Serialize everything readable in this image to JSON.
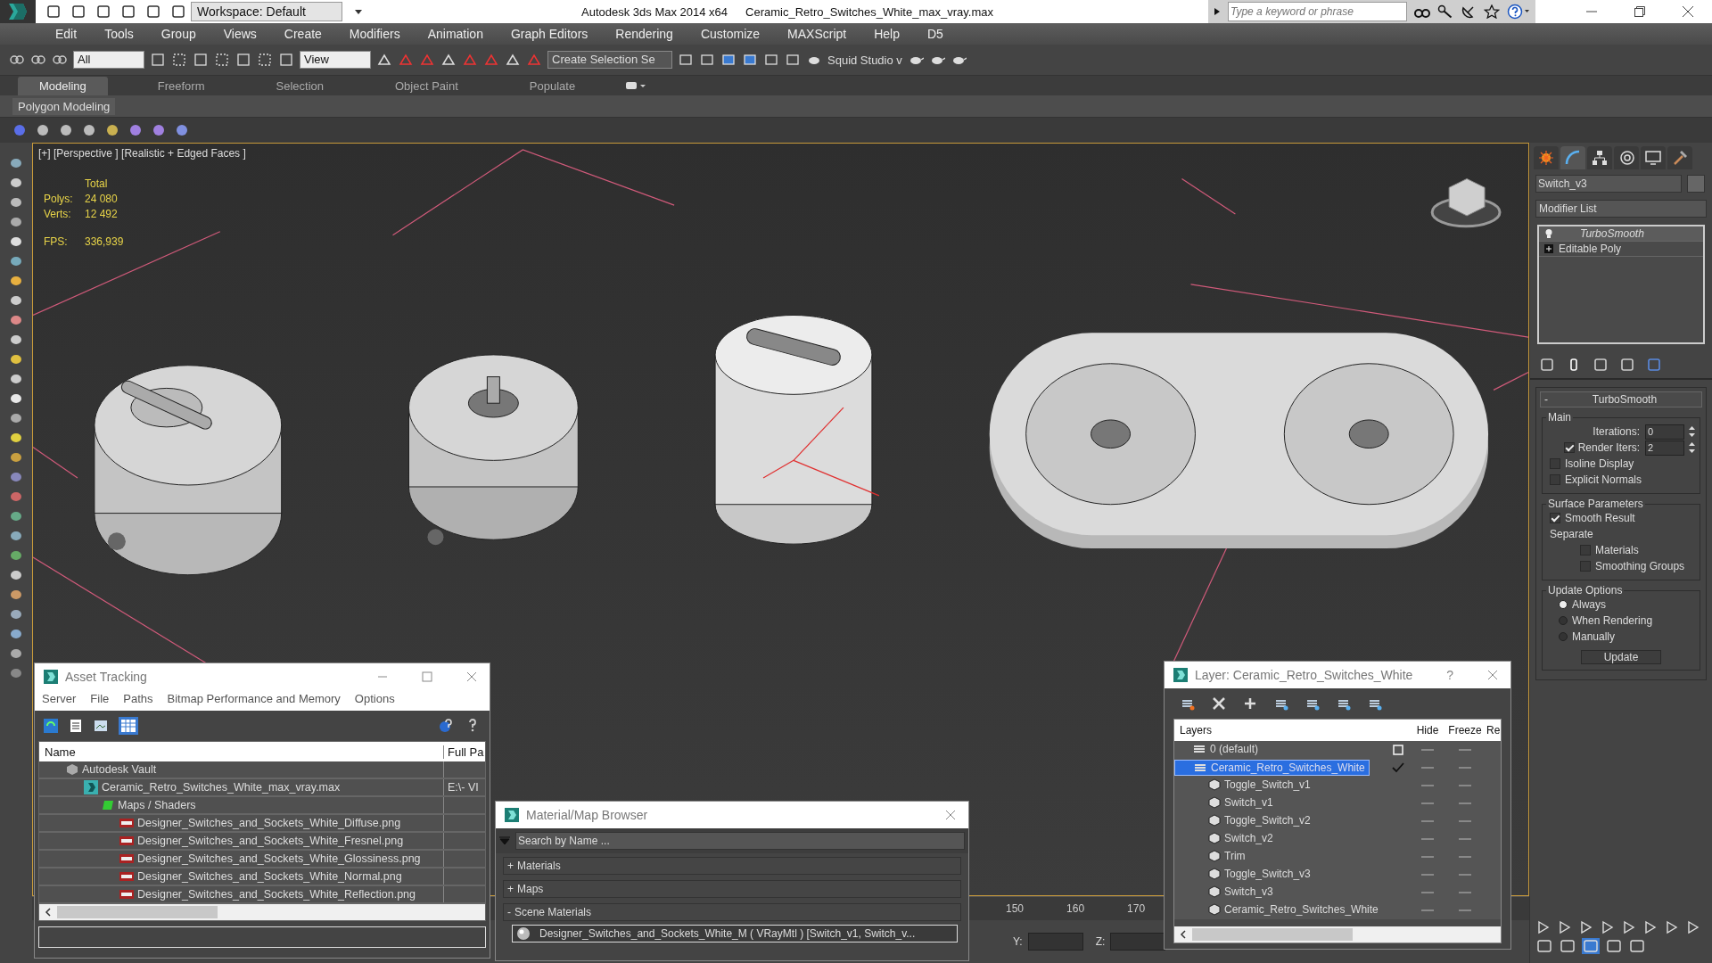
{
  "title_bar": {
    "workspace": "Workspace: Default",
    "app_title": "Autodesk 3ds Max  2014 x64",
    "file_name": "Ceramic_Retro_Switches_White_max_vray.max",
    "search": {
      "placeholder": "Type a keyword or phrase"
    }
  },
  "menu_bar": [
    "Edit",
    "Tools",
    "Group",
    "Views",
    "Create",
    "Modifiers",
    "Animation",
    "Graph Editors",
    "Rendering",
    "Customize",
    "MAXScript",
    "Help",
    "D5"
  ],
  "main_toolbar": {
    "selection_filter": "All",
    "reference_coord": "View",
    "named_selection": "Create Selection Se",
    "plugin_label": "Squid Studio v"
  },
  "ribbon": {
    "tabs": [
      {
        "label": "Modeling",
        "selected": true
      },
      {
        "label": "Freeform",
        "selected": false
      },
      {
        "label": "Selection",
        "selected": false
      },
      {
        "label": "Object Paint",
        "selected": false
      },
      {
        "label": "Populate",
        "selected": false
      }
    ],
    "panel_label": "Polygon Modeling"
  },
  "viewport": {
    "label": "[+] [Perspective ] [Realistic + Edged Faces ]",
    "stats": {
      "header": "Total",
      "rows": [
        {
          "label": "Polys:",
          "value": "24 080"
        },
        {
          "label": "Verts:",
          "value": "12 492"
        }
      ],
      "fps_label": "FPS:",
      "fps_value": "336,939"
    }
  },
  "command_panel": {
    "tabs": [
      {
        "kind": "create",
        "selected": false
      },
      {
        "kind": "modify",
        "selected": true
      },
      {
        "kind": "hierarchy",
        "selected": false
      },
      {
        "kind": "motion",
        "selected": false
      },
      {
        "kind": "display",
        "selected": false
      },
      {
        "kind": "utilities",
        "selected": false
      }
    ],
    "object_name": "Switch_v3",
    "modifier_list": "Modifier List",
    "stack": [
      {
        "label": "TurboSmooth",
        "kind": "modifier"
      },
      {
        "label": "Editable Poly",
        "kind": "base"
      }
    ],
    "rollout": {
      "sign": "-",
      "title": "TurboSmooth",
      "groups": [
        {
          "title": "Main",
          "controls": [
            {
              "kind": "spinner",
              "label": "Iterations:",
              "value": "0"
            },
            {
              "kind": "check_spinner",
              "label": "Render Iters:",
              "value": "2",
              "checked": true
            },
            {
              "kind": "checkbox",
              "label": "Isoline Display",
              "checked": false
            },
            {
              "kind": "checkbox",
              "label": "Explicit Normals",
              "checked": false
            }
          ]
        },
        {
          "title": "Surface Parameters",
          "controls": [
            {
              "kind": "checkbox",
              "label": "Smooth Result",
              "checked": true
            },
            {
              "kind": "label",
              "label": "Separate"
            },
            {
              "kind": "sub_checkbox",
              "label": "Materials",
              "checked": false
            },
            {
              "kind": "sub_checkbox",
              "label": "Smoothing Groups",
              "checked": false
            }
          ]
        },
        {
          "title": "Update Options",
          "controls": [
            {
              "kind": "radio",
              "label": "Always",
              "selected": true
            },
            {
              "kind": "radio",
              "label": "When Rendering",
              "selected": false
            },
            {
              "kind": "radio",
              "label": "Manually",
              "selected": false
            },
            {
              "kind": "button",
              "label": "Update"
            }
          ]
        }
      ]
    }
  },
  "timeline": {
    "ticks": [
      "150",
      "160",
      "170"
    ]
  },
  "coordinates": [
    "Y:",
    "Z:"
  ],
  "asset_tracking": {
    "title": "Asset Tracking",
    "menu": [
      "Server",
      "File",
      "Paths",
      "Bitmap Performance and Memory",
      "Options"
    ],
    "columns": [
      "Name",
      "Full Pa"
    ],
    "rows": [
      {
        "kind": "vault",
        "name": "Autodesk Vault",
        "children": [
          {
            "kind": "max",
            "name": "Ceramic_Retro_Switches_White_max_vray.max",
            "path": "E:\\- VI",
            "children": [
              {
                "kind": "folder",
                "name": "Maps / Shaders",
                "children": [
                  {
                    "kind": "png",
                    "name": "Designer_Switches_and_Sockets_White_Diffuse.png"
                  },
                  {
                    "kind": "png",
                    "name": "Designer_Switches_and_Sockets_White_Fresnel.png"
                  },
                  {
                    "kind": "png",
                    "name": "Designer_Switches_and_Sockets_White_Glossiness.png"
                  },
                  {
                    "kind": "png",
                    "name": "Designer_Switches_and_Sockets_White_Normal.png"
                  },
                  {
                    "kind": "png",
                    "name": "Designer_Switches_and_Sockets_White_Reflection.png"
                  }
                ]
              }
            ]
          }
        ]
      }
    ]
  },
  "material_browser": {
    "title": "Material/Map Browser",
    "search": {
      "placeholder": "Search by Name ..."
    },
    "groups": [
      {
        "sign": "+",
        "label": "Materials"
      },
      {
        "sign": "+",
        "label": "Maps"
      },
      {
        "sign": "-",
        "label": "Scene Materials",
        "items": [
          "Designer_Switches_and_Sockets_White_M  ( VRayMtl )  [Switch_v1, Switch_v..."
        ]
      }
    ]
  },
  "layer_window": {
    "title": "Layer: Ceramic_Retro_Switches_White",
    "help": "?",
    "columns": [
      "Layers",
      "Hide",
      "Freeze",
      "Re"
    ],
    "layers": [
      {
        "kind": "layer",
        "name": "0 (default)",
        "selected": false,
        "current": false
      },
      {
        "kind": "layer",
        "name": "Ceramic_Retro_Switches_White",
        "selected": true,
        "current": true,
        "children": [
          {
            "kind": "object",
            "name": "Toggle_Switch_v1",
            "selected": false
          },
          {
            "kind": "object",
            "name": "Switch_v1",
            "selected": false
          },
          {
            "kind": "object",
            "name": "Toggle_Switch_v2",
            "selected": false
          },
          {
            "kind": "object",
            "name": "Switch_v2",
            "selected": false
          },
          {
            "kind": "object",
            "name": "Trim",
            "selected": false
          },
          {
            "kind": "object",
            "name": "Toggle_Switch_v3",
            "selected": false
          },
          {
            "kind": "object",
            "name": "Switch_v3",
            "selected": false
          },
          {
            "kind": "object",
            "name": "Ceramic_Retro_Switches_White",
            "selected": false
          }
        ]
      }
    ]
  }
}
